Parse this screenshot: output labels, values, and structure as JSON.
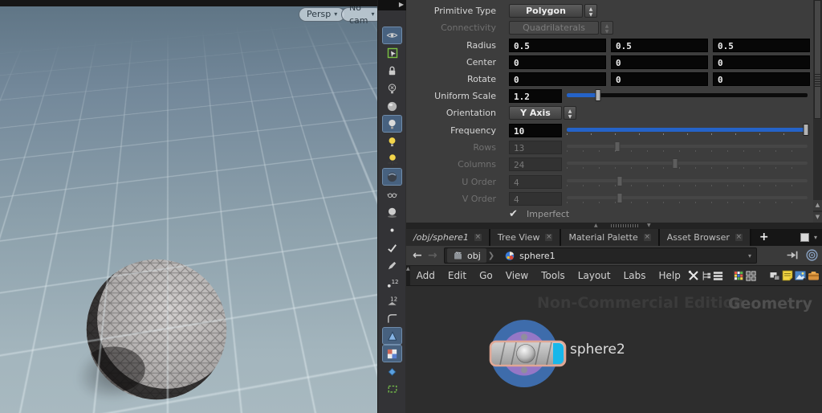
{
  "viewport": {
    "persp_button": "Persp",
    "cam_button": "No cam",
    "dropdown_arrow": "▾"
  },
  "display_toolbar": {
    "icons": [
      "visibility-eye",
      "select-box",
      "lock",
      "light-disabled",
      "render-sphere",
      "headlight",
      "point-light",
      "light-move",
      "material-sphere",
      "glasses",
      "shadow-sphere",
      "points",
      "brush-check",
      "pen",
      "point-numbers",
      "primitive-numbers",
      "curve-corner",
      "cone-handle",
      "uv-checker",
      "handle-diamond",
      "group-box"
    ]
  },
  "params": {
    "rows": [
      {
        "label": "Primitive Type",
        "value": "Polygon"
      },
      {
        "label": "Connectivity",
        "value": "Quadrilaterals"
      },
      {
        "label": "Radius",
        "values": [
          "0.5",
          "0.5",
          "0.5"
        ]
      },
      {
        "label": "Center",
        "values": [
          "0",
          "0",
          "0"
        ]
      },
      {
        "label": "Rotate",
        "values": [
          "0",
          "0",
          "0"
        ]
      },
      {
        "label": "Uniform Scale",
        "value": "1.2",
        "fill_style": "width:13%",
        "handle_style": "left:13%"
      },
      {
        "label": "Orientation",
        "value": "Y Axis"
      },
      {
        "label": "Frequency",
        "value": "10",
        "fill_style": "width:100%",
        "handle_style": "left:99.2%"
      },
      {
        "label": "Rows",
        "value": "13",
        "handle_style": "left:21%"
      },
      {
        "label": "Columns",
        "value": "24",
        "handle_style": "left:45%"
      },
      {
        "label": "U Order",
        "value": "4",
        "handle_style": "left:22%"
      },
      {
        "label": "V Order",
        "value": "4",
        "handle_style": "left:22%"
      },
      {
        "label": "Imperfect",
        "checkmark": "✔"
      }
    ],
    "spinner_up": "▲",
    "spinner_down": "▼"
  },
  "tabbar": {
    "tabs": [
      {
        "label": "/obj/sphere1"
      },
      {
        "label": "Tree View"
      },
      {
        "label": "Material Palette"
      },
      {
        "label": "Asset Browser"
      }
    ],
    "close_glyph": "×",
    "new_tab_label": "+",
    "menu_arrow": "▾"
  },
  "pathbar": {
    "back_glyph": "←",
    "forward_glyph": "→",
    "crumbs": [
      {
        "label": "obj"
      },
      {
        "label": "sphere1"
      }
    ],
    "separator": "❯",
    "dropdown_arrow": "▾"
  },
  "menubar": {
    "items": [
      "Add",
      "Edit",
      "Go",
      "View",
      "Tools",
      "Layout",
      "Labs",
      "Help"
    ],
    "icons": [
      "tools",
      "tree-view",
      "list",
      "color-palette",
      "layout-grid",
      "panels",
      "sticky-note",
      "image",
      "toolbox",
      "search",
      "eye"
    ]
  },
  "network": {
    "watermark": "Non-Commercial Edition",
    "context_label": "Geometry",
    "node": {
      "name": "sphere2"
    }
  },
  "colors": {
    "accent_blue": "#2563c8",
    "node_ring_blue": "#3e6cab",
    "node_core_purple": "#9577c6",
    "node_flag_cyan": "#17b7ea",
    "node_border_salmon": "#e0a795",
    "viewport_top": "#5e7484",
    "viewport_bottom": "#a8b9c0"
  }
}
